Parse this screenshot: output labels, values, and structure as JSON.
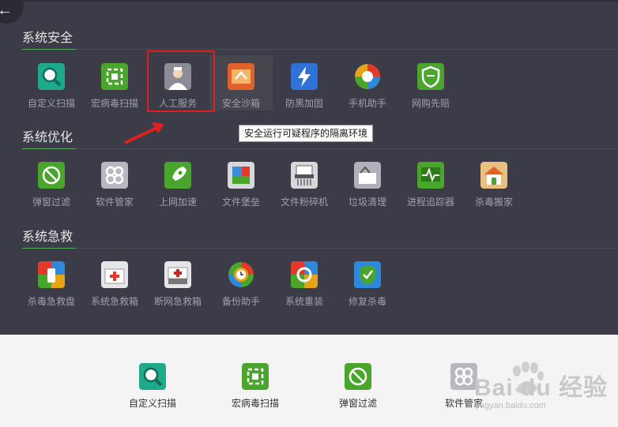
{
  "sections": [
    {
      "title": "系统安全"
    },
    {
      "title": "系统优化"
    },
    {
      "title": "系统急救"
    }
  ],
  "security_tools": [
    {
      "label": "自定义扫描",
      "icon": "magnifier-scan-icon",
      "color": "#1ea88c"
    },
    {
      "label": "宏病毒扫描",
      "icon": "macro-virus-scan-icon",
      "color": "#4aa52c"
    },
    {
      "label": "人工服务",
      "icon": "doctor-service-icon",
      "color": "#8c8c96"
    },
    {
      "label": "安全沙箱",
      "icon": "sandbox-icon",
      "color": "#e0622a"
    },
    {
      "label": "防黑加固",
      "icon": "anti-hack-icon",
      "color": "#2e72d8"
    },
    {
      "label": "手机助手",
      "icon": "phone-assistant-icon",
      "color": "#e8a418"
    },
    {
      "label": "网购先赔",
      "icon": "shopping-shield-icon",
      "color": "#4aa52c"
    }
  ],
  "optimize_tools": [
    {
      "label": "弹窗过滤",
      "icon": "popup-filter-icon",
      "color": "#4aa52c"
    },
    {
      "label": "软件管家",
      "icon": "software-manager-icon",
      "color": "#b8b8c0"
    },
    {
      "label": "上网加速",
      "icon": "rocket-speedup-icon",
      "color": "#4aa52c"
    },
    {
      "label": "文件堡垒",
      "icon": "file-fortress-icon",
      "color": "#3a8ed8"
    },
    {
      "label": "文件粉碎机",
      "icon": "file-shredder-icon",
      "color": "#d8d8dc"
    },
    {
      "label": "垃圾清理",
      "icon": "junk-clean-icon",
      "color": "#b0b0b8"
    },
    {
      "label": "进程追踪器",
      "icon": "process-tracker-icon",
      "color": "#4aa52c"
    },
    {
      "label": "杀毒搬家",
      "icon": "antivirus-move-icon",
      "color": "#e0a040"
    }
  ],
  "rescue_tools": [
    {
      "label": "杀毒急救盘",
      "icon": "rescue-disk-icon",
      "color": "#e23a2a"
    },
    {
      "label": "系统急救箱",
      "icon": "system-firstaid-icon",
      "color": "#e23a2a"
    },
    {
      "label": "断网急救箱",
      "icon": "offline-firstaid-icon",
      "color": "#c02828"
    },
    {
      "label": "备份助手",
      "icon": "backup-icon",
      "color": "#e8a418"
    },
    {
      "label": "系统重装",
      "icon": "system-reinstall-icon",
      "color": "#e23a2a"
    },
    {
      "label": "修复杀毒",
      "icon": "repair-antivirus-icon",
      "color": "#2e8ad8"
    }
  ],
  "tooltip": "安全运行可疑程序的隔离环境",
  "back_glyph": "←",
  "bottom_tools": [
    {
      "label": "自定义扫描",
      "icon": "magnifier-scan-icon"
    },
    {
      "label": "宏病毒扫描",
      "icon": "macro-virus-scan-icon"
    },
    {
      "label": "弹窗过滤",
      "icon": "popup-filter-icon"
    },
    {
      "label": "软件管家",
      "icon": "software-manager-icon"
    }
  ],
  "watermark": {
    "main": "Bai du 经验",
    "sub": "jingyan.baidu.com"
  }
}
